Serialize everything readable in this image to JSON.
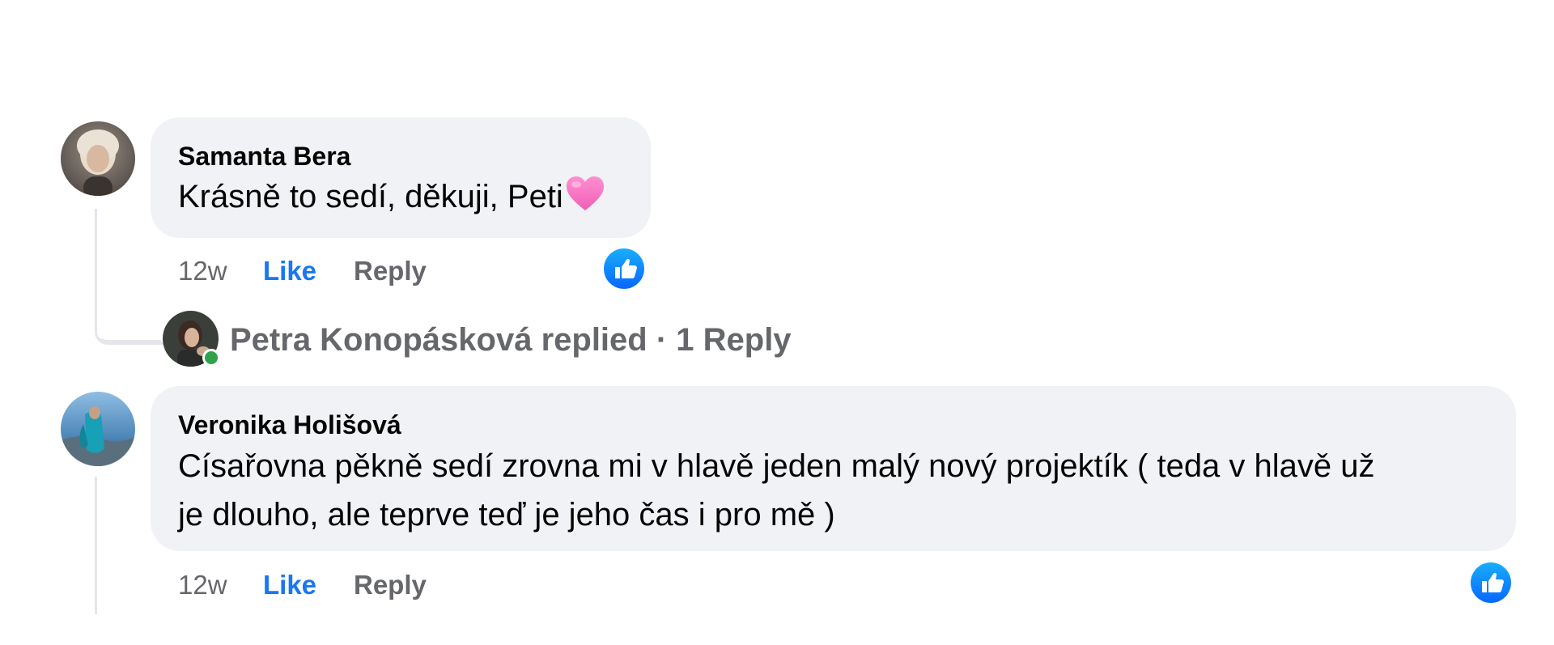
{
  "comments": [
    {
      "author": "Samanta Bera",
      "text": "Krásně to sedí, děkuji, Peti",
      "emoji": "pink-heart-icon",
      "time": "12w",
      "like_label": "Like",
      "reply_label": "Reply",
      "reaction": "like-reaction-icon"
    },
    {
      "author": "Veronika Holišová",
      "text_line1": "Císařovna pěkně sedí zrovna mi v hlavě jeden malý nový projektík ( teda v hlavě už",
      "text_line2": "je dlouho, ale teprve teď je jeho čas i pro mě )",
      "time": "12w",
      "like_label": "Like",
      "reply_label": "Reply",
      "reaction": "like-reaction-icon"
    }
  ],
  "reply_summary": {
    "text": "Petra Konopásková replied · 1 Reply",
    "online_status": "online"
  },
  "colors": {
    "bubble": "#f0f2f5",
    "link_blue": "#1877f2",
    "secondary_text": "#65676b",
    "thread_line": "#e4e6eb",
    "online_green": "#31a24c"
  }
}
